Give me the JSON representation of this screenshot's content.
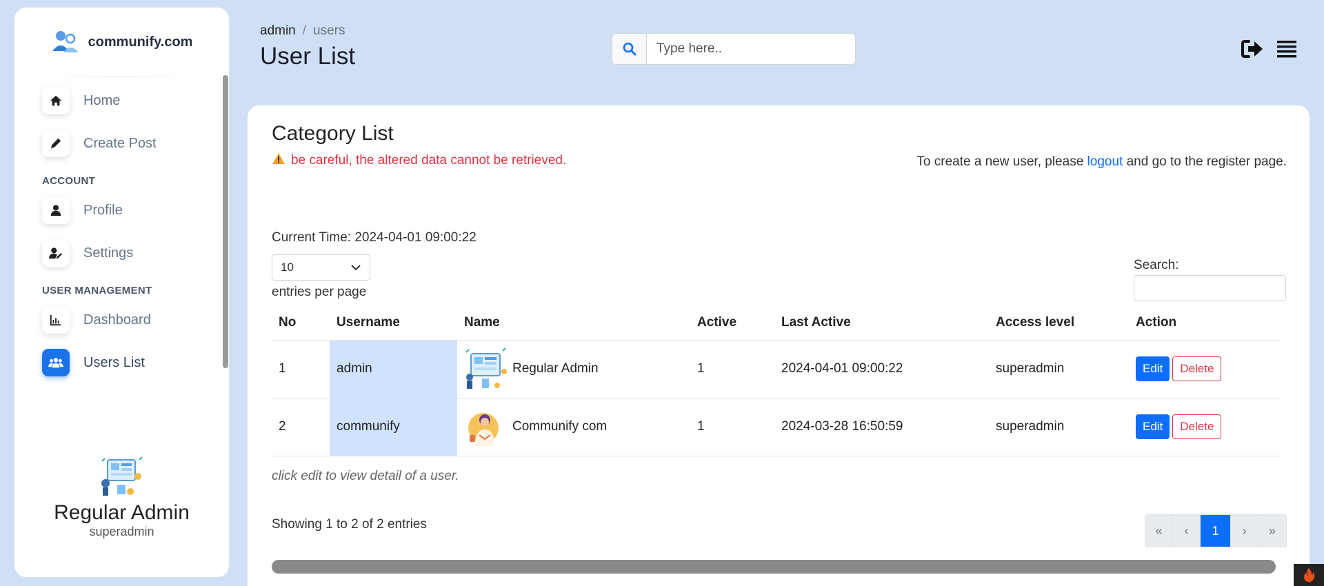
{
  "sidebar": {
    "brand": "communify.com",
    "items_top": [
      {
        "label": "Home",
        "icon": "home-icon"
      },
      {
        "label": "Create Post",
        "icon": "pencil-icon"
      }
    ],
    "section_account": "ACCOUNT",
    "items_account": [
      {
        "label": "Profile",
        "icon": "user-icon"
      },
      {
        "label": "Settings",
        "icon": "user-settings-icon"
      }
    ],
    "section_user_mgmt": "USER MANAGEMENT",
    "items_user_mgmt": [
      {
        "label": "Dashboard",
        "icon": "chart-icon"
      },
      {
        "label": "Users List",
        "icon": "users-icon",
        "active": true
      }
    ],
    "profile": {
      "name": "Regular Admin",
      "role": "superadmin"
    }
  },
  "header": {
    "breadcrumb_parent": "admin",
    "breadcrumb_sep": "/",
    "breadcrumb_current": "users",
    "title": "User List",
    "search_placeholder": "Type here.."
  },
  "card": {
    "title": "Category List",
    "warning": "be careful, the altered data cannot be retrieved.",
    "register_note_pre": "To create a new user, please ",
    "register_note_link": "logout",
    "register_note_post": " and go to the register page.",
    "current_time": "Current Time: 2024-04-01 09:00:22",
    "entries_value": "10",
    "entries_label": "entries per page",
    "search_label": "Search:",
    "table": {
      "headers": [
        "No",
        "Username",
        "Name",
        "Active",
        "Last Active",
        "Access level",
        "Action"
      ],
      "rows": [
        {
          "no": "1",
          "username": "admin",
          "name": "Regular Admin",
          "active": "1",
          "last_active": "2024-04-01 09:00:22",
          "access": "superadmin"
        },
        {
          "no": "2",
          "username": "communify",
          "name": "Communify com",
          "active": "1",
          "last_active": "2024-03-28 16:50:59",
          "access": "superadmin"
        }
      ],
      "edit_label": "Edit",
      "delete_label": "Delete"
    },
    "table_note": "click edit to view detail of a user.",
    "showing": "Showing 1 to 2 of 2 entries",
    "pagination": {
      "first": "«",
      "prev": "‹",
      "current": "1",
      "next": "›",
      "last": "»"
    }
  },
  "colors": {
    "accent": "#0d6efd",
    "danger": "#dc3545",
    "background": "#cfdff5",
    "highlight": "#cfe2ff"
  }
}
